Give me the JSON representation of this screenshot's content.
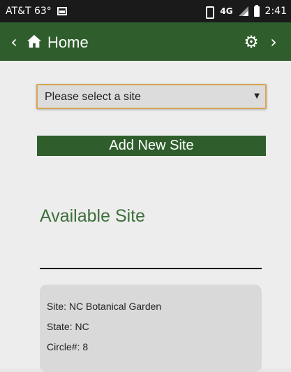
{
  "status_bar": {
    "carrier": "AT&T 63°",
    "network": "4G",
    "time": "2:41",
    "icons": [
      "image-icon",
      "vibrate-icon",
      "signal-icon",
      "battery-icon"
    ]
  },
  "app_bar": {
    "title": "Home",
    "back_icon": "‹",
    "forward_icon": "›",
    "gear_icon": "⚙"
  },
  "site_select": {
    "value": "Please select a site",
    "caret": "▼"
  },
  "add_button": {
    "label": "Add New Site"
  },
  "available": {
    "title": "Available Site"
  },
  "site_card": {
    "site": "Site: NC Botanical Garden",
    "state": "State: NC",
    "circle": "Circle#: 8"
  },
  "colors": {
    "brand_green": "#2f5e2c",
    "title_green": "#3e6f3a",
    "select_border": "#d8a654"
  }
}
